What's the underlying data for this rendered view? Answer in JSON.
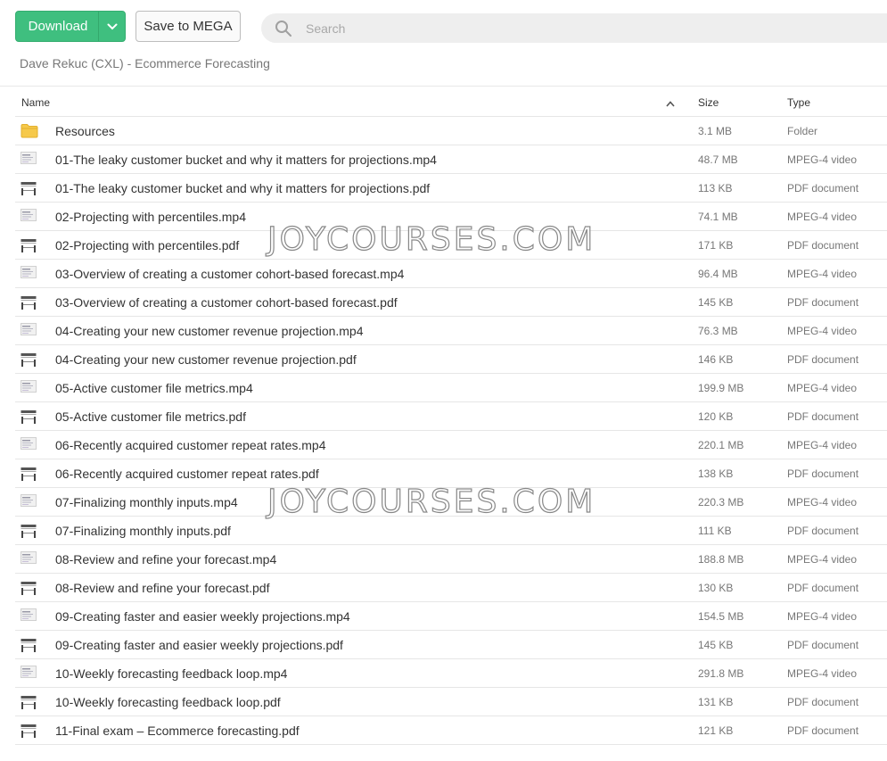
{
  "toolbar": {
    "download_label": "Download",
    "save_label": "Save to MEGA",
    "accent": "#3fbf7f"
  },
  "search": {
    "placeholder": "Search"
  },
  "breadcrumb": "Dave Rekuc (CXL) - Ecommerce Forecasting",
  "columns": {
    "name": "Name",
    "size": "Size",
    "type": "Type"
  },
  "files": [
    {
      "name": "Resources",
      "size": "3.1 MB",
      "type": "Folder",
      "icon": "folder-icon"
    },
    {
      "name": "01-The leaky customer bucket and why it matters for projections.mp4",
      "size": "48.7 MB",
      "type": "MPEG-4 video",
      "icon": "video-thumbnail-icon"
    },
    {
      "name": "01-The leaky customer bucket and why it matters for projections.pdf",
      "size": "113 KB",
      "type": "PDF document",
      "icon": "pdf-thumbnail-icon"
    },
    {
      "name": "02-Projecting with percentiles.mp4",
      "size": "74.1 MB",
      "type": "MPEG-4 video",
      "icon": "video-thumbnail-icon"
    },
    {
      "name": "02-Projecting with percentiles.pdf",
      "size": "171 KB",
      "type": "PDF document",
      "icon": "pdf-thumbnail-icon"
    },
    {
      "name": "03-Overview of creating a customer cohort-based forecast.mp4",
      "size": "96.4 MB",
      "type": "MPEG-4 video",
      "icon": "video-thumbnail-icon"
    },
    {
      "name": "03-Overview of creating a customer cohort-based forecast.pdf",
      "size": "145 KB",
      "type": "PDF document",
      "icon": "pdf-thumbnail-icon"
    },
    {
      "name": "04-Creating your new customer revenue projection.mp4",
      "size": "76.3 MB",
      "type": "MPEG-4 video",
      "icon": "video-thumbnail-icon"
    },
    {
      "name": "04-Creating your new customer revenue projection.pdf",
      "size": "146 KB",
      "type": "PDF document",
      "icon": "pdf-thumbnail-icon"
    },
    {
      "name": "05-Active customer file metrics.mp4",
      "size": "199.9 MB",
      "type": "MPEG-4 video",
      "icon": "video-thumbnail-icon"
    },
    {
      "name": "05-Active customer file metrics.pdf",
      "size": "120 KB",
      "type": "PDF document",
      "icon": "pdf-thumbnail-icon"
    },
    {
      "name": "06-Recently acquired customer repeat rates.mp4",
      "size": "220.1 MB",
      "type": "MPEG-4 video",
      "icon": "video-thumbnail-icon"
    },
    {
      "name": "06-Recently acquired customer repeat rates.pdf",
      "size": "138 KB",
      "type": "PDF document",
      "icon": "pdf-thumbnail-icon"
    },
    {
      "name": "07-Finalizing monthly inputs.mp4",
      "size": "220.3 MB",
      "type": "MPEG-4 video",
      "icon": "video-thumbnail-icon"
    },
    {
      "name": "07-Finalizing monthly inputs.pdf",
      "size": "111 KB",
      "type": "PDF document",
      "icon": "pdf-thumbnail-icon"
    },
    {
      "name": "08-Review and refine your forecast.mp4",
      "size": "188.8 MB",
      "type": "MPEG-4 video",
      "icon": "video-thumbnail-icon"
    },
    {
      "name": "08-Review and refine your forecast.pdf",
      "size": "130 KB",
      "type": "PDF document",
      "icon": "pdf-thumbnail-icon"
    },
    {
      "name": "09-Creating faster and easier weekly projections.mp4",
      "size": "154.5 MB",
      "type": "MPEG-4 video",
      "icon": "video-thumbnail-icon"
    },
    {
      "name": "09-Creating faster and easier weekly projections.pdf",
      "size": "145 KB",
      "type": "PDF document",
      "icon": "pdf-thumbnail-icon"
    },
    {
      "name": "10-Weekly forecasting feedback loop.mp4",
      "size": "291.8 MB",
      "type": "MPEG-4 video",
      "icon": "video-thumbnail-icon"
    },
    {
      "name": "10-Weekly forecasting feedback loop.pdf",
      "size": "131 KB",
      "type": "PDF document",
      "icon": "pdf-thumbnail-icon"
    },
    {
      "name": "11-Final exam – Ecommerce forecasting.pdf",
      "size": "121 KB",
      "type": "PDF document",
      "icon": "pdf-thumbnail-icon"
    }
  ],
  "watermark": "JOYCOURSES.COM"
}
